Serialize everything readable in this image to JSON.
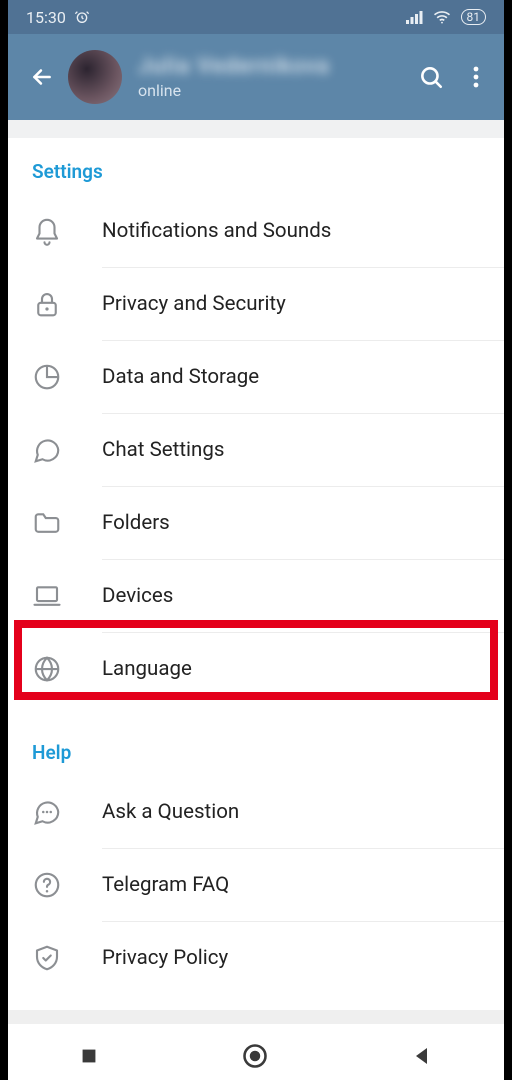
{
  "statusbar": {
    "time": "15:30",
    "battery": "81"
  },
  "header": {
    "name_blur": "Julia Vedernikova",
    "status": "online"
  },
  "sections": {
    "settings_title": "Settings",
    "help_title": "Help"
  },
  "settings_items": [
    {
      "label": "Notifications and Sounds"
    },
    {
      "label": "Privacy and Security"
    },
    {
      "label": "Data and Storage"
    },
    {
      "label": "Chat Settings"
    },
    {
      "label": "Folders"
    },
    {
      "label": "Devices"
    },
    {
      "label": "Language"
    }
  ],
  "help_items": [
    {
      "label": "Ask a Question"
    },
    {
      "label": "Telegram FAQ"
    },
    {
      "label": "Privacy Policy"
    }
  ]
}
